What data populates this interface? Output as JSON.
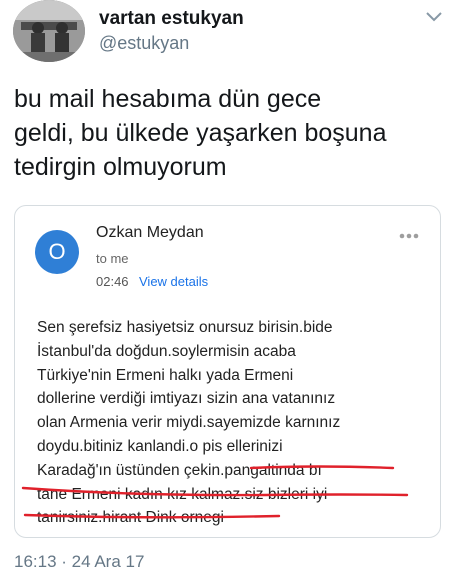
{
  "author": {
    "name": "vartan estukyan",
    "handle": "@estukyan"
  },
  "tweet": {
    "lines": [
      "bu mail hesabıma dün gece",
      "geldi, bu ülkede yaşarken boşuna",
      "tedirgin olmuyorum"
    ],
    "timestamp": "16:13 · 24 Ara 17"
  },
  "email": {
    "avatar_letter": "O",
    "avatar_color": "#2f7fd6",
    "sender": "Ozkan Meydan",
    "to": "to me",
    "time": "02:46",
    "view_details": "View details",
    "body_lines": [
      "Sen şerefsiz hasiyetsiz onursuz birisin.bide",
      "İstanbul'da doğdun.soylermisin acaba",
      "Türkiye'nin Ermeni halkı yada Ermeni",
      "dollerine verdiği imtiyazı sizin ana vatanınız",
      "olan Armenia verir miydi.sayemizde karnınız",
      "doydu.bitiniz kanlandi.o pis ellerinizi",
      "Karadağ'ın üstünden çekin.pangaltinda bı",
      "tane Ermeni kadın kız kalmaz.siz bizleri iyi",
      "tanirsiniz.hirant Dink ornegi"
    ],
    "link_color": "#1a73e8",
    "annotation_color": "#e0212b"
  },
  "icons": {
    "caret": "chevron-down-icon",
    "more": "more-horizontal-icon"
  }
}
